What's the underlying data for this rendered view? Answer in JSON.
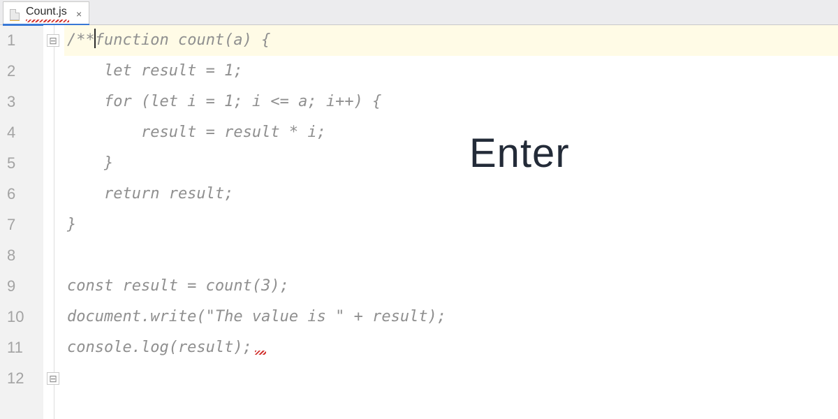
{
  "tab": {
    "filename": "Count.js",
    "filetype_badge": "JS",
    "close_glyph": "×"
  },
  "gutter": {
    "line_numbers": [
      "1",
      "2",
      "3",
      "4",
      "5",
      "6",
      "7",
      "8",
      "9",
      "10",
      "11",
      "12"
    ]
  },
  "fold": {
    "open_row": 1,
    "close_row": 12,
    "open_glyph": "⊟",
    "close_glyph": "⊟"
  },
  "code": {
    "caret_line": 1,
    "caret_prefix": "/**",
    "caret_suffix": "function count(a) {",
    "lines": [
      "/**function count(a) {",
      "    let result = 1;",
      "    for (let i = 1; i <= a; i++) {",
      "        result = result * i;",
      "    }",
      "    return result;",
      "}",
      "",
      "const result = count(3);",
      "document.write(\"The value is \" + result);",
      "console.log(result);",
      ""
    ],
    "trailing_squiggle_line": 11
  },
  "overlay": {
    "keyhint": "Enter"
  },
  "colors": {
    "highlight_bg": "#fffbe6",
    "tab_underline": "#3978d6",
    "error_squiggle": "#d1322f",
    "gutter_bg": "#f2f2f2"
  }
}
